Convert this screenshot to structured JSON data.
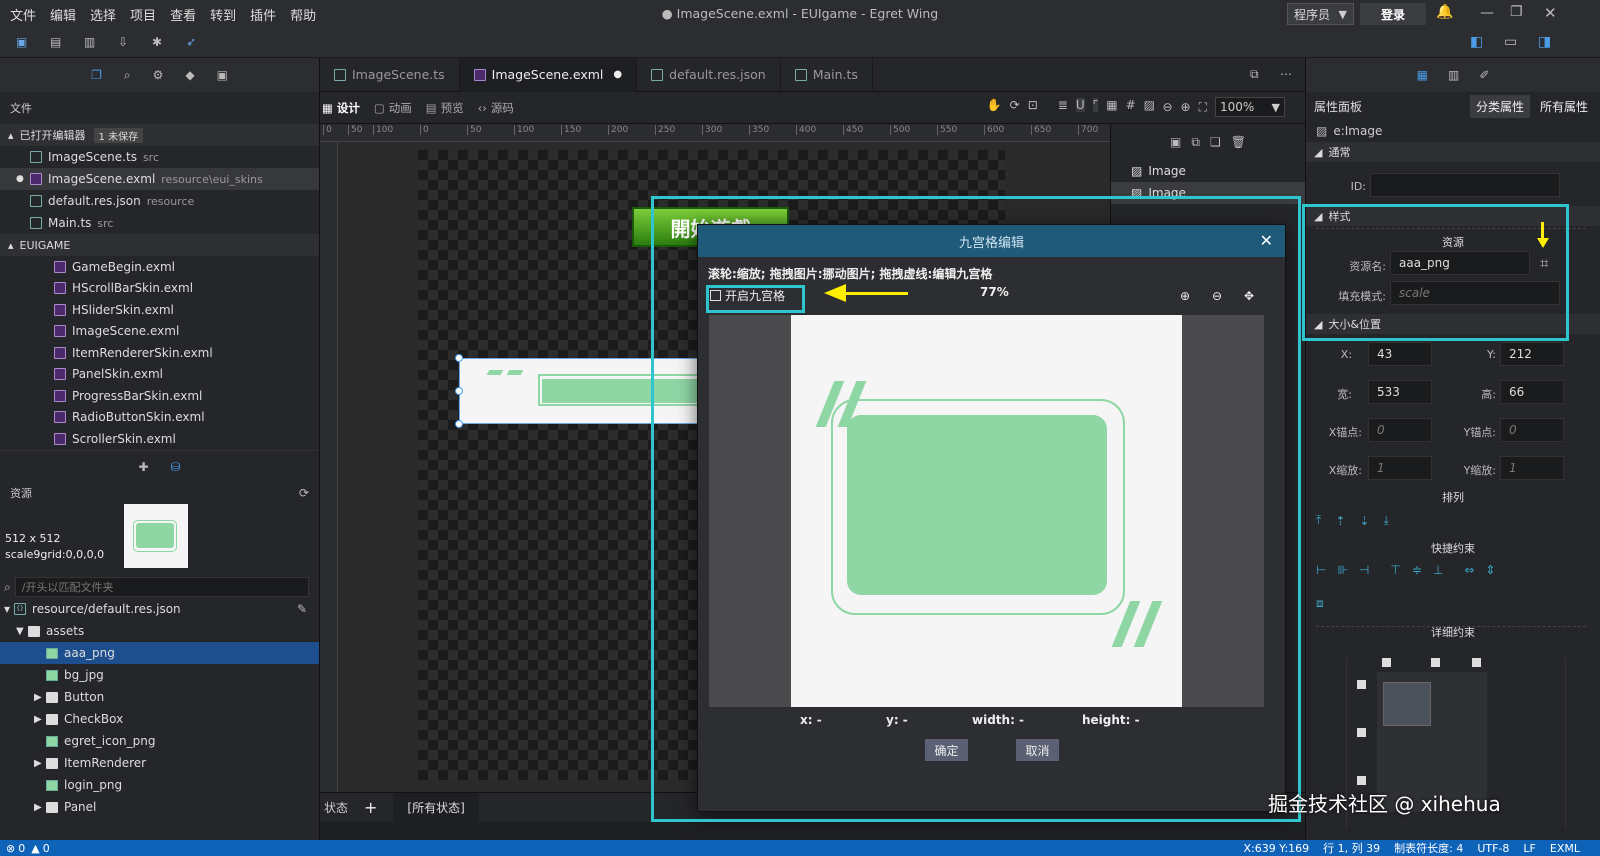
{
  "menu": [
    "文件",
    "编辑",
    "选择",
    "项目",
    "查看",
    "转到",
    "插件",
    "帮助"
  ],
  "window_title": "● ImageScene.exml - EUIgame - Egret Wing",
  "user_role": "程序员",
  "login_label": "登录",
  "left": {
    "files_title": "文件",
    "open_editors": "已打开编辑器",
    "unsaved": "1 未保存",
    "open_files": [
      {
        "name": "ImageScene.ts",
        "path": "src"
      },
      {
        "name": "ImageScene.exml",
        "path": "resource\\eui_skins"
      },
      {
        "name": "default.res.json",
        "path": "resource"
      },
      {
        "name": "Main.ts",
        "path": "src"
      }
    ],
    "project": "EUIGAME",
    "skins": [
      "GameBegin.exml",
      "HScrollBarSkin.exml",
      "HSliderSkin.exml",
      "ImageScene.exml",
      "ItemRendererSkin.exml",
      "PanelSkin.exml",
      "ProgressBarSkin.exml",
      "RadioButtonSkin.exml",
      "ScrollerSkin.exml"
    ],
    "assets_title": "资源",
    "preview_size": "512 x 512",
    "preview_grid": "scale9grid:0,0,0,0",
    "search_placeholder": "/开头以匹配文件夹",
    "res_file": "resource/default.res.json",
    "tree": [
      {
        "label": "assets",
        "level": 1,
        "kind": "folder-open"
      },
      {
        "label": "aaa_png",
        "level": 2,
        "kind": "image",
        "selected": true
      },
      {
        "label": "bg_jpg",
        "level": 2,
        "kind": "image"
      },
      {
        "label": "Button",
        "level": 2,
        "kind": "folder"
      },
      {
        "label": "CheckBox",
        "level": 2,
        "kind": "folder"
      },
      {
        "label": "egret_icon_png",
        "level": 2,
        "kind": "image"
      },
      {
        "label": "ItemRenderer",
        "level": 2,
        "kind": "folder"
      },
      {
        "label": "login_png",
        "level": 2,
        "kind": "image"
      },
      {
        "label": "Panel",
        "level": 2,
        "kind": "folder"
      }
    ]
  },
  "tabs": [
    "ImageScene.ts",
    "ImageScene.exml",
    "default.res.json",
    "Main.ts"
  ],
  "design_modes": [
    "设计",
    "动画",
    "预览",
    "源码"
  ],
  "zoom": "100%",
  "ruler_ticks": [
    "0",
    "50",
    "100",
    "0",
    "50",
    "100",
    "150",
    "200",
    "250",
    "300",
    "350",
    "400",
    "450",
    "500",
    "550",
    "600",
    "650",
    "700"
  ],
  "outline_items": [
    "Image",
    "Image"
  ],
  "state_label": "状态",
  "all_states": "[所有状态]",
  "scene_button_text": "開始遊戲",
  "dialog": {
    "title": "九宫格编辑",
    "hint": "滚轮:缩放; 拖拽图片:挪动图片; 拖拽虚线:编辑九宫格",
    "enable_label": "开启九宫格",
    "percent": "77%",
    "coords": [
      "x: -",
      "y: -",
      "width: -",
      "height: -"
    ],
    "ok": "确定",
    "cancel": "取消"
  },
  "right": {
    "title": "属性面板",
    "tab_category": "分类属性",
    "tab_all": "所有属性",
    "element": "e:Image",
    "sec_common": "通常",
    "id_label": "ID:",
    "sec_style": "样式",
    "res_group": "资源",
    "res_name_label": "资源名:",
    "res_name": "aaa_png",
    "fill_label": "填充模式:",
    "fill_value": "scale",
    "sec_size": "大小&位置",
    "x_label": "X:",
    "x": "43",
    "y_label": "Y:",
    "y": "212",
    "w_label": "宽:",
    "w": "533",
    "h_label": "高:",
    "h": "66",
    "ax_label": "X锚点:",
    "ax": "0",
    "ay_label": "Y锚点:",
    "ay": "0",
    "sx_label": "X缩放:",
    "sx": "1",
    "sy_label": "Y缩放:",
    "sy": "1",
    "arrange": "排列",
    "quick": "快捷约束",
    "detail": "详细约束"
  },
  "statusbar": {
    "errors": "0",
    "warnings": "0",
    "pos": "X:639 Y:169",
    "line": "行 1, 列 39",
    "tab": "制表符长度: 4",
    "enc": "UTF-8",
    "eol": "LF",
    "lang": "EXML"
  },
  "watermark": "掘金技术社区 @ xihehua",
  "colors": {
    "accent_cyan": "#2fc5cf",
    "arrow_yellow": "#ffee00",
    "status_blue": "#0e63b8",
    "dialog_title": "#1f5a7a",
    "mint": "#8fd6a5"
  }
}
